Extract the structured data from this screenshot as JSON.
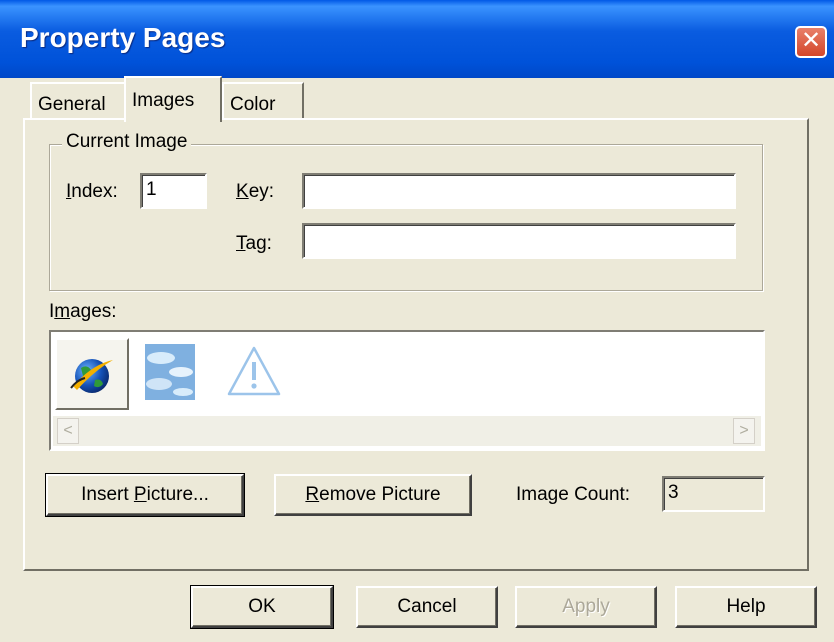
{
  "window": {
    "title": "Property Pages",
    "close_glyph": "✕"
  },
  "tabs": [
    {
      "label": "General",
      "active": false
    },
    {
      "label": "Images",
      "active": true
    },
    {
      "label": "Color",
      "active": false
    }
  ],
  "current_image": {
    "group_label": "Current Image",
    "index": {
      "label_accel": "I",
      "label_rest": "ndex:",
      "value": "1"
    },
    "key": {
      "label_accel": "K",
      "label_rest": "ey:",
      "value": ""
    },
    "tag": {
      "label_accel": "T",
      "label_rest": "ag:",
      "value": ""
    }
  },
  "images": {
    "label_pre": "I",
    "label_accel": "m",
    "label_rest": "ages:",
    "items": [
      {
        "icon": "globe-icon",
        "selected": true
      },
      {
        "icon": "clouds-icon",
        "selected": false
      },
      {
        "icon": "warning-icon",
        "selected": false
      }
    ],
    "scroll_left": "<",
    "scroll_right": ">"
  },
  "actions": {
    "insert_pre": "Insert ",
    "insert_accel": "P",
    "insert_rest": "icture...",
    "remove_accel": "R",
    "remove_rest": "emove Picture",
    "image_count_label": "Image Count:",
    "image_count_value": "3"
  },
  "footer": {
    "ok": "OK",
    "cancel": "Cancel",
    "apply": "Apply",
    "help": "Help"
  },
  "colors": {
    "title_bar": "#0054e3",
    "dialog_bg": "#ece9d8",
    "close_button": "#d3472a"
  }
}
